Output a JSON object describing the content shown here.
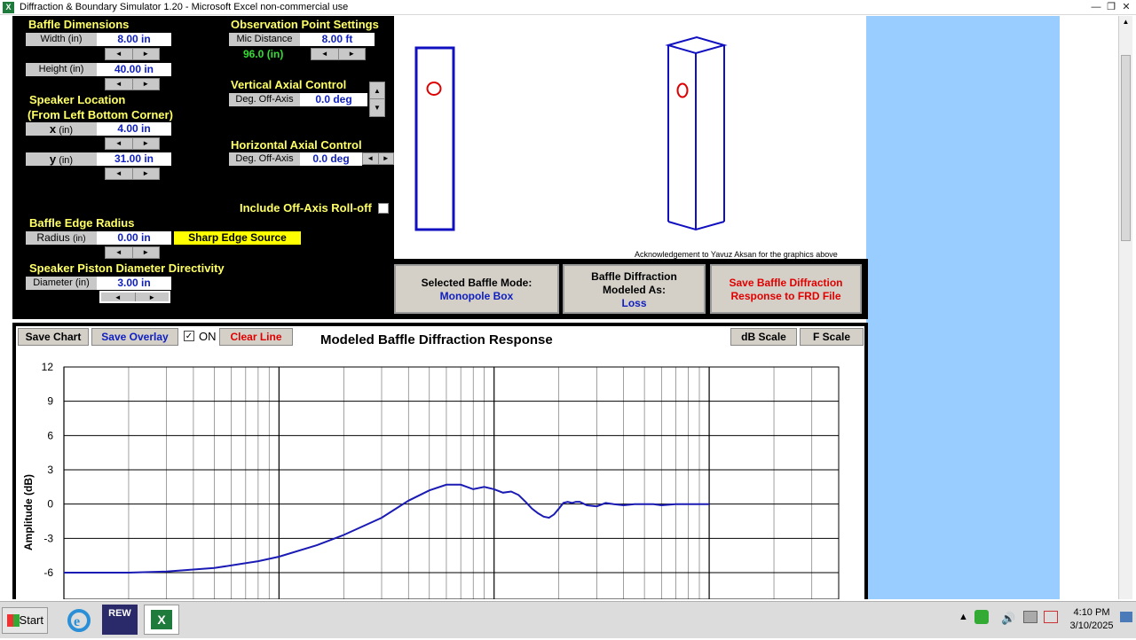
{
  "window": {
    "title": "Diffraction & Boundary Simulator 1.20 - Microsoft Excel non-commercial use",
    "app_icon": "X"
  },
  "baffle_dimensions": {
    "heading": "Baffle Dimensions",
    "width_label": "Width (in)",
    "width_value": "8.00 in",
    "height_label": "Height (in)",
    "height_value": "40.00 in"
  },
  "speaker_location": {
    "heading1": "Speaker Location",
    "heading2": "(From Left Bottom Corner)",
    "x_label": "x",
    "x_unit": "(in)",
    "x_value": "4.00 in",
    "y_label": "y",
    "y_unit": "(in)",
    "y_value": "31.00 in"
  },
  "observation": {
    "heading": "Observation Point Settings",
    "mic_label": "Mic Distance",
    "mic_value": "8.00 ft",
    "mic_inches": "96.0 (in)"
  },
  "vertical_axial": {
    "heading": "Vertical Axial Control",
    "label": "Deg. Off-Axis",
    "value": "0.0 deg"
  },
  "horizontal_axial": {
    "heading": "Horizontal Axial Control",
    "label": "Deg. Off-Axis",
    "value": "0.0 deg"
  },
  "rolloff": {
    "label": "Include Off-Axis Roll-off",
    "checked": false
  },
  "edge_radius": {
    "heading": "Baffle Edge Radius",
    "label": "Radius",
    "unit": "(in)",
    "value": "0.00 in",
    "source_badge": "Sharp Edge Source"
  },
  "piston": {
    "heading": "Speaker Piston Diameter Directivity",
    "label": "Diameter (in)",
    "value": "3.00 in"
  },
  "spin_arrows": {
    "left": "◄",
    "right": "►",
    "up": "▲",
    "down": "▼"
  },
  "acknowledgement": "Acknowledgement to Yavuz Aksan for the graphics above",
  "mode_boxes": {
    "selected_label": "Selected Baffle Mode:",
    "selected_value": "Monopole Box",
    "modeled_label1": "Baffle Diffraction",
    "modeled_label2": "Modeled As:",
    "modeled_value": "Loss",
    "save_frd1": "Save Baffle Diffraction",
    "save_frd2": "Response to FRD File"
  },
  "chart_toolbar": {
    "save_chart": "Save Chart",
    "save_overlay": "Save Overlay",
    "on_label": "ON",
    "on_checked": true,
    "clear_line": "Clear Line",
    "db_scale": "dB Scale",
    "f_scale": "F Scale"
  },
  "colors": {
    "panel": "#000000",
    "heading": "#ffff66",
    "value": "#1020c0",
    "trace": "#1a1ab4",
    "red": "#e00000",
    "lightblue": "#99ccff"
  },
  "chart_data": {
    "type": "line",
    "title": "Modeled Baffle Diffraction Response",
    "ylabel": "Amplitude (dB)",
    "xlabel": "",
    "xscale": "log",
    "xlim": [
      10,
      40000
    ],
    "ylim": [
      -6,
      12
    ],
    "yticks": [
      12,
      9,
      6,
      3,
      0,
      -3,
      -6
    ],
    "grid": true,
    "series": [
      {
        "x": [
          10,
          20,
          30,
          50,
          80,
          100,
          150,
          200,
          300,
          400,
          500,
          600,
          700,
          800,
          900,
          1000,
          1100,
          1200,
          1300,
          1400,
          1500,
          1600,
          1700,
          1800,
          1900,
          2000,
          2100,
          2200,
          2300,
          2400,
          2500,
          2700,
          3000,
          3300,
          3600,
          4000,
          4500,
          5000,
          5500,
          6000,
          7000,
          8000,
          9000,
          10000
        ],
        "y": [
          -6.0,
          -6.0,
          -5.9,
          -5.6,
          -5.0,
          -4.6,
          -3.6,
          -2.7,
          -1.2,
          0.3,
          1.2,
          1.7,
          1.7,
          1.3,
          1.5,
          1.3,
          1.0,
          1.1,
          0.8,
          0.2,
          -0.4,
          -0.8,
          -1.1,
          -1.2,
          -0.9,
          -0.4,
          0.1,
          0.2,
          0.1,
          0.2,
          0.2,
          -0.1,
          -0.2,
          0.1,
          0.0,
          -0.1,
          0.0,
          0.0,
          0.0,
          -0.1,
          0.0,
          0.0,
          0.0,
          0.0
        ]
      }
    ]
  },
  "taskbar": {
    "start": "Start",
    "rew": "REW",
    "time": "4:10 PM",
    "date": "3/10/2025"
  }
}
